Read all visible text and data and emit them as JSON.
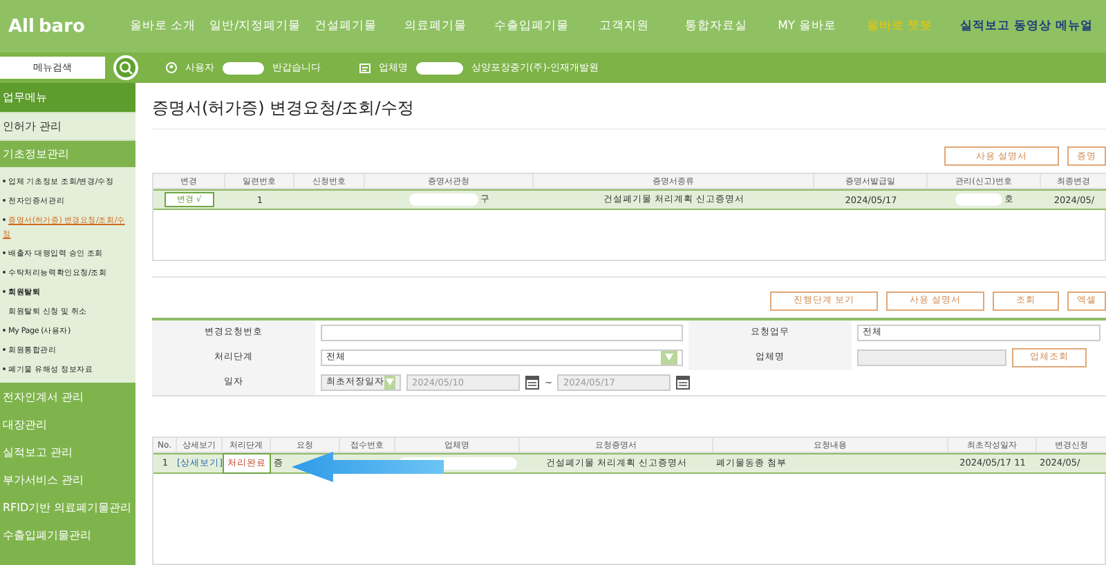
{
  "logo": {
    "text_left": "All",
    "text_right": "baro"
  },
  "nav": [
    {
      "label": "올바로 소개",
      "kind": "normal"
    },
    {
      "label": "일반/지정폐기물",
      "kind": "normal"
    },
    {
      "label": "건설폐기물",
      "kind": "normal"
    },
    {
      "label": "의료폐기물",
      "kind": "normal"
    },
    {
      "label": "수출입폐기물",
      "kind": "normal"
    },
    {
      "label": "고객지원",
      "kind": "normal"
    },
    {
      "label": "통합자료실",
      "kind": "normal"
    },
    {
      "label": "MY 올바로",
      "kind": "normal"
    },
    {
      "label": "올바로 챗봇",
      "kind": "highlight"
    },
    {
      "label": "실적보고 동영상 메뉴얼",
      "kind": "video"
    }
  ],
  "subbar": {
    "search_placeholder": "메뉴검색",
    "user_prefix": "사용자",
    "user_suffix": "반갑습니다",
    "company_prefix": "업체명",
    "company_suffix": "상양포장중기(주)-인재개발원"
  },
  "sidebar": {
    "header": "업무메뉴",
    "sections": [
      {
        "label": "인허가 관리",
        "kind": "light"
      },
      {
        "label": "기초정보관리",
        "kind": "green"
      }
    ],
    "items": [
      {
        "label": "업체 기초정보 조회/변경/수정",
        "kind": "bullet",
        "selected": false
      },
      {
        "label": "전자인증서관리",
        "kind": "bullet",
        "selected": false
      },
      {
        "label": "증명서(허가증) 변경요청/조회/수정",
        "kind": "bullet",
        "selected": true
      },
      {
        "label": "배출자 대행입력 승인 조회",
        "kind": "bullet",
        "selected": false
      },
      {
        "label": "수탁처리능력확인요청/조회",
        "kind": "bullet",
        "selected": false
      },
      {
        "label": "회원탈퇴",
        "kind": "group",
        "selected": false
      },
      {
        "label": "회원탈퇴 신청 및 취소",
        "kind": "sub",
        "selected": false
      },
      {
        "label": "My Page (사용자)",
        "kind": "bullet",
        "selected": false
      },
      {
        "label": "회원통합관리",
        "kind": "bullet",
        "selected": false
      },
      {
        "label": "폐기물 유해성 정보자료",
        "kind": "bullet",
        "selected": false
      }
    ],
    "bottom": [
      "전자인계서 관리",
      "대장관리",
      "실적보고 관리",
      "부가서비스 관리",
      "RFID기반 의료폐기물관리",
      "수출입폐기물관리"
    ]
  },
  "page_title": "증명서(허가증) 변경요청/조회/수정",
  "top_buttons": [
    "사용 설명서",
    "증명"
  ],
  "cert_table": {
    "columns": [
      "변경",
      "일련번호",
      "신청번호",
      "증명서관청",
      "증명서종류",
      "증명서발급일",
      "관리(신고)번호",
      "최종변경"
    ],
    "rows": [
      {
        "selected": true,
        "change": "변경 √",
        "no": "1",
        "office": "구",
        "type": "건설폐기물 처리계획 신고증명서",
        "issued": "2024/05/17",
        "manage_no": "호",
        "last_changed": "2024/05/"
      }
    ]
  },
  "search_buttons": [
    "진행단계 보기",
    "사용 설명서",
    "조회",
    "엑셀"
  ],
  "form": {
    "request_no_label": "변경요청번호",
    "task_label": "요청업무",
    "task_value": "전체",
    "stage_label": "처리단계",
    "stage_value": "전체",
    "company_label": "업체명",
    "company_button": "업체조회",
    "date_label": "일자",
    "date_type": "최초저장일자",
    "date_from": "2024/05/10",
    "date_sep": "~",
    "date_to": "2024/05/17"
  },
  "request_table": {
    "columns": [
      "No.",
      "상세보기",
      "처리단계",
      "요청",
      "접수번호",
      "업체명",
      "요청증명서",
      "요청내용",
      "최초작성일자",
      "변경신청"
    ],
    "rows": [
      {
        "selected": true,
        "no": "1",
        "detail": "[상세보기]",
        "stage": "처리완료",
        "task": "증",
        "cert": "건설폐기물 처리계획 신고증명서",
        "content": "폐기물동종 첨부",
        "created": "2024/05/17 11",
        "changed": "2024/05/"
      }
    ]
  }
}
